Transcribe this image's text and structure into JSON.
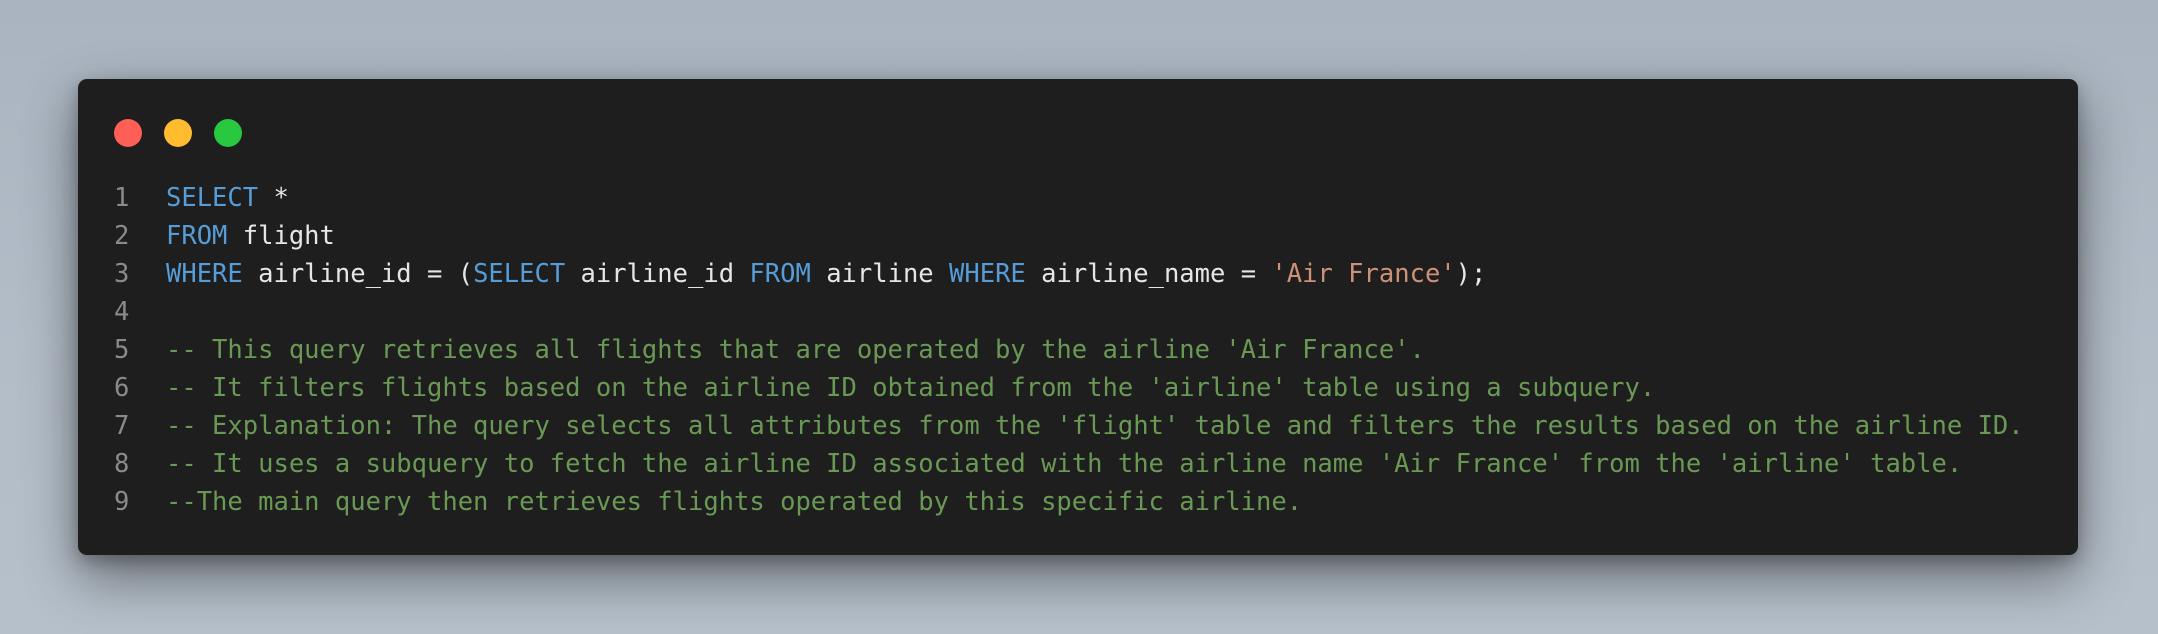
{
  "window": {
    "controls": {
      "close_color": "#ff5f57",
      "minimize_color": "#febc2e",
      "maximize_color": "#28c840"
    }
  },
  "theme": {
    "background": "#1e1e1e",
    "keyword_color": "#569cd6",
    "string_color": "#ce9178",
    "comment_color": "#6a9955",
    "text_color": "#e6e6e6",
    "line_number_color": "#8a8a8a"
  },
  "code": {
    "lines": [
      {
        "number": "1",
        "tokens": [
          {
            "type": "kw",
            "text": "SELECT"
          },
          {
            "type": "pl",
            "text": " *"
          }
        ]
      },
      {
        "number": "2",
        "tokens": [
          {
            "type": "kw",
            "text": "FROM"
          },
          {
            "type": "pl",
            "text": " flight"
          }
        ]
      },
      {
        "number": "3",
        "tokens": [
          {
            "type": "kw",
            "text": "WHERE"
          },
          {
            "type": "pl",
            "text": " airline_id = ("
          },
          {
            "type": "kw",
            "text": "SELECT"
          },
          {
            "type": "pl",
            "text": " airline_id "
          },
          {
            "type": "kw",
            "text": "FROM"
          },
          {
            "type": "pl",
            "text": " airline "
          },
          {
            "type": "kw",
            "text": "WHERE"
          },
          {
            "type": "pl",
            "text": " airline_name = "
          },
          {
            "type": "str",
            "text": "'Air France'"
          },
          {
            "type": "pl",
            "text": ");"
          }
        ]
      },
      {
        "number": "4",
        "tokens": []
      },
      {
        "number": "5",
        "tokens": [
          {
            "type": "cm",
            "text": "-- This query retrieves all flights that are operated by the airline 'Air France'."
          }
        ]
      },
      {
        "number": "6",
        "tokens": [
          {
            "type": "cm",
            "text": "-- It filters flights based on the airline ID obtained from the 'airline' table using a subquery."
          }
        ]
      },
      {
        "number": "7",
        "tokens": [
          {
            "type": "cm",
            "text": "-- Explanation: The query selects all attributes from the 'flight' table and filters the results based on the airline ID."
          }
        ]
      },
      {
        "number": "8",
        "tokens": [
          {
            "type": "cm",
            "text": "-- It uses a subquery to fetch the airline ID associated with the airline name 'Air France' from the 'airline' table."
          }
        ]
      },
      {
        "number": "9",
        "tokens": [
          {
            "type": "cm",
            "text": "--The main query then retrieves flights operated by this specific airline."
          }
        ]
      }
    ]
  }
}
